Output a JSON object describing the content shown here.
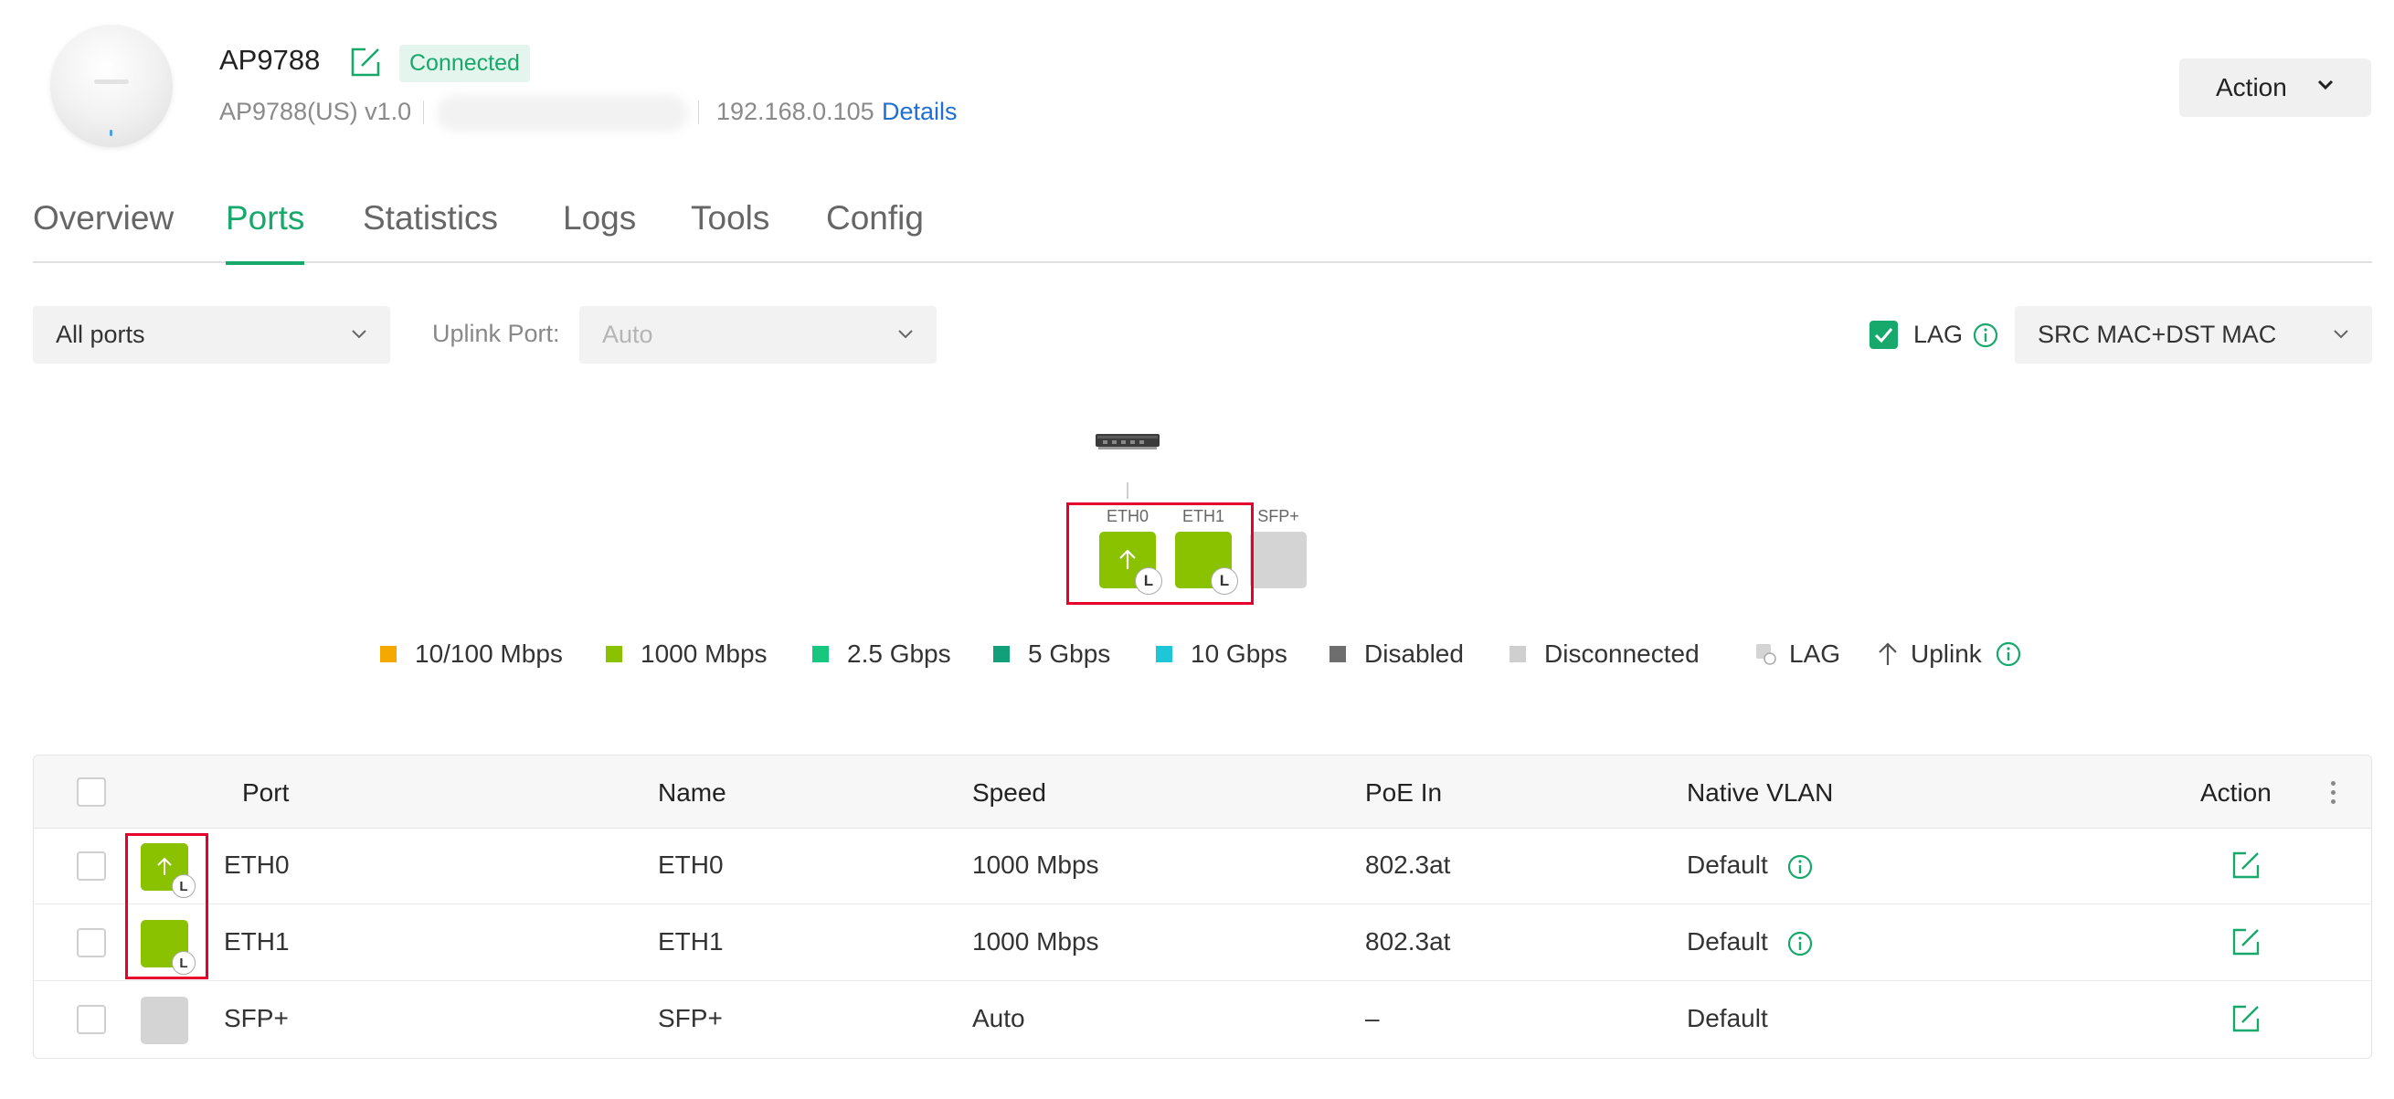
{
  "device": {
    "name": "AP9788",
    "status": "Connected",
    "model": "AP9788(US) v1.0",
    "ip": "192.168.0.105",
    "details_link": "Details"
  },
  "header": {
    "action_label": "Action"
  },
  "tabs": [
    {
      "label": "Overview"
    },
    {
      "label": "Ports"
    },
    {
      "label": "Statistics"
    },
    {
      "label": "Logs"
    },
    {
      "label": "Tools"
    },
    {
      "label": "Config"
    }
  ],
  "active_tab": "Ports",
  "filters": {
    "port_filter": "All ports",
    "uplink_label": "Uplink Port:",
    "uplink_value": "Auto",
    "lag_label": "LAG",
    "lag_checked": true,
    "hash_mode": "SRC MAC+DST MAC"
  },
  "topology": {
    "ports": [
      {
        "label": "ETH0",
        "color": "#8ac200",
        "uplink": true,
        "lag": "L"
      },
      {
        "label": "ETH1",
        "color": "#8ac200",
        "uplink": false,
        "lag": "L"
      },
      {
        "label": "SFP+",
        "color": "#d4d4d4",
        "uplink": false,
        "lag": ""
      }
    ]
  },
  "legend": [
    {
      "label": "10/100 Mbps",
      "color": "#f5a800"
    },
    {
      "label": "1000 Mbps",
      "color": "#8ac200"
    },
    {
      "label": "2.5 Gbps",
      "color": "#17c77d"
    },
    {
      "label": "5 Gbps",
      "color": "#12a07a"
    },
    {
      "label": "10 Gbps",
      "color": "#1ec7d8"
    },
    {
      "label": "Disabled",
      "color": "#6e6e6e"
    },
    {
      "label": "Disconnected",
      "color": "#cfcfcf"
    },
    {
      "label": "LAG",
      "icon": "lag-icon"
    },
    {
      "label": "Uplink",
      "icon": "uplink-arrow-icon"
    }
  ],
  "table": {
    "headers": [
      "Port",
      "Name",
      "Speed",
      "PoE In",
      "Native VLAN",
      "Action"
    ],
    "rows": [
      {
        "port": "ETH0",
        "name": "ETH0",
        "speed": "1000 Mbps",
        "poe": "802.3at",
        "vlan": "Default",
        "color": "#8ac200",
        "uplink": true,
        "lag": "L"
      },
      {
        "port": "ETH1",
        "name": "ETH1",
        "speed": "1000 Mbps",
        "poe": "802.3at",
        "vlan": "Default",
        "color": "#8ac200",
        "uplink": false,
        "lag": "L"
      },
      {
        "port": "SFP+",
        "name": "SFP+",
        "speed": "Auto",
        "poe": "–",
        "vlan": "Default",
        "color": "#d4d4d4",
        "uplink": false,
        "lag": ""
      }
    ]
  }
}
